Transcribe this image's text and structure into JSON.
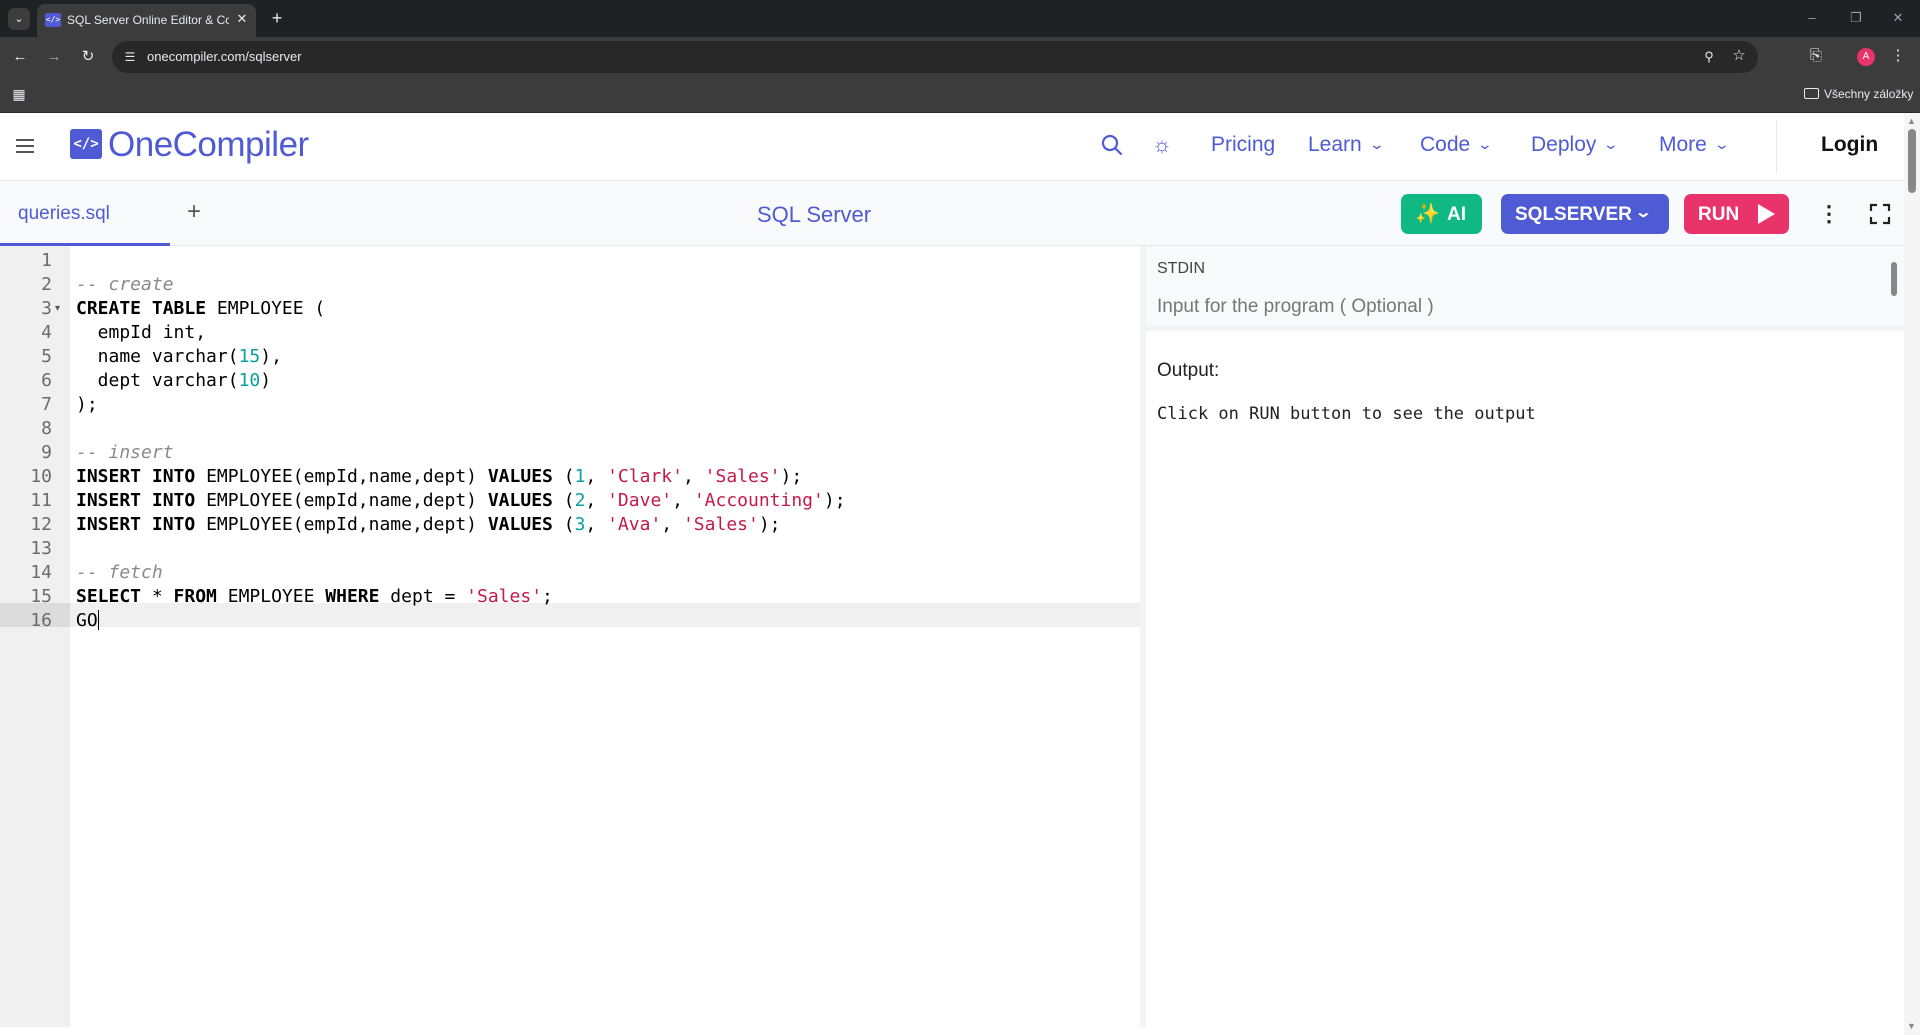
{
  "browser": {
    "tab_title": "SQL Server Online Editor & Compiler",
    "url": "onecompiler.com/sqlserver",
    "bookmarks_folder": "Všechny záložky",
    "profile_initial": "A"
  },
  "header": {
    "logo_mark": "</>",
    "logo_text": "OneCompiler",
    "nav": [
      "Pricing",
      "Learn",
      "Code",
      "Deploy",
      "More"
    ],
    "login": "Login"
  },
  "editor_bar": {
    "file_tab": "queries.sql",
    "language_title": "SQL Server",
    "ai_label": "AI",
    "language_select": "SQLSERVER",
    "run_label": "RUN"
  },
  "editor": {
    "line_numbers": [
      "1",
      "2",
      "3",
      "4",
      "5",
      "6",
      "7",
      "8",
      "9",
      "10",
      "11",
      "12",
      "13",
      "14",
      "15",
      "16"
    ],
    "lines": [
      "",
      "-- create",
      "CREATE TABLE EMPLOYEE (",
      "  empId int,",
      "  name varchar(15),",
      "  dept varchar(10)",
      ");",
      "",
      "-- insert",
      "INSERT INTO EMPLOYEE(empId,name,dept) VALUES (1, 'Clark', 'Sales');",
      "INSERT INTO EMPLOYEE(empId,name,dept) VALUES (2, 'Dave', 'Accounting');",
      "INSERT INTO EMPLOYEE(empId,name,dept) VALUES (3, 'Ava', 'Sales');",
      "",
      "-- fetch",
      "SELECT * FROM EMPLOYEE WHERE dept = 'Sales';",
      "GO"
    ],
    "active_line": 16
  },
  "io": {
    "stdin_label": "STDIN",
    "stdin_placeholder": "Input for the program ( Optional )",
    "output_label": "Output:",
    "output_text": "Click on RUN button to see the output"
  },
  "colors": {
    "brand": "#4f5bd5",
    "ai": "#10b981",
    "run": "#e8336b"
  }
}
